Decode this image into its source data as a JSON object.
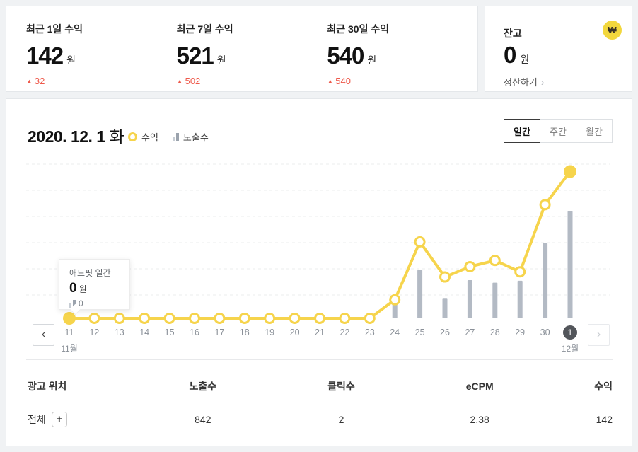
{
  "colors": {
    "accent_yellow": "#f6d44c",
    "bar_gray": "#b3bac4",
    "delta_red": "#ee5a4c",
    "selected_chip_bg": "#53565b",
    "won_badge_bg": "#f2d73d",
    "grid_line": "#ebecee"
  },
  "summary": {
    "up_arrow": "▲",
    "stats": [
      {
        "label": "최근 1일 수익",
        "value": "142",
        "unit": "원",
        "delta": "32"
      },
      {
        "label": "최근 7일 수익",
        "value": "521",
        "unit": "원",
        "delta": "502"
      },
      {
        "label": "최근 30일 수익",
        "value": "540",
        "unit": "원",
        "delta": "540"
      }
    ],
    "balance": {
      "label": "잔고",
      "value": "0",
      "unit": "원",
      "action": "정산하기",
      "action_chevron": "›",
      "won_icon_glyph": "₩"
    }
  },
  "chart_panel": {
    "title_date": "2020. 12. 1",
    "title_day": "화",
    "legend": [
      {
        "label": "수익",
        "icon": "revenue-ring-icon"
      },
      {
        "label": "노출수",
        "icon": "impressions-bars-icon"
      }
    ],
    "tabs": [
      {
        "label": "일간",
        "active": true
      },
      {
        "label": "주간",
        "active": false
      },
      {
        "label": "월간",
        "active": false
      }
    ],
    "nav_prev": "‹",
    "nav_next": "›",
    "tooltip": {
      "title": "애드핏 일간",
      "value": "0",
      "unit": "원",
      "impressions": "0"
    }
  },
  "chart_data": {
    "type": "line+bar",
    "x_labels": [
      "11",
      "12",
      "13",
      "14",
      "15",
      "16",
      "17",
      "18",
      "19",
      "20",
      "21",
      "22",
      "23",
      "24",
      "25",
      "26",
      "27",
      "28",
      "29",
      "30",
      "1"
    ],
    "month_markers": [
      {
        "index": 0,
        "label": "11월"
      },
      {
        "index": 20,
        "label": "12월"
      }
    ],
    "series": [
      {
        "name": "수익",
        "type": "line",
        "color": "#f6d44c",
        "values": [
          0,
          0,
          0,
          0,
          0,
          0,
          0,
          0,
          0,
          0,
          0,
          0,
          0,
          18,
          74,
          40,
          50,
          56,
          45,
          110,
          142
        ]
      },
      {
        "name": "노출수",
        "type": "bar",
        "color": "#b3bac4",
        "values": [
          0,
          0,
          0,
          0,
          0,
          0,
          0,
          0,
          0,
          0,
          0,
          0,
          0,
          130,
          380,
          160,
          300,
          280,
          295,
          590,
          842
        ]
      }
    ],
    "revenue_ylim": [
      0,
      154
    ],
    "impressions_ylim": [
      0,
      1250
    ],
    "selected_index": 0,
    "end_highlight_index": 20,
    "grid": "dashed-horizontal",
    "legend_position": "top",
    "y_axis_labels": "hidden"
  },
  "table": {
    "headers": [
      "광고 위치",
      "노출수",
      "클릭수",
      "eCPM",
      "수익"
    ],
    "rows": [
      {
        "name": "전체",
        "expand": "+",
        "impressions": "842",
        "clicks": "2",
        "ecpm": "2.38",
        "revenue": "142"
      }
    ]
  }
}
